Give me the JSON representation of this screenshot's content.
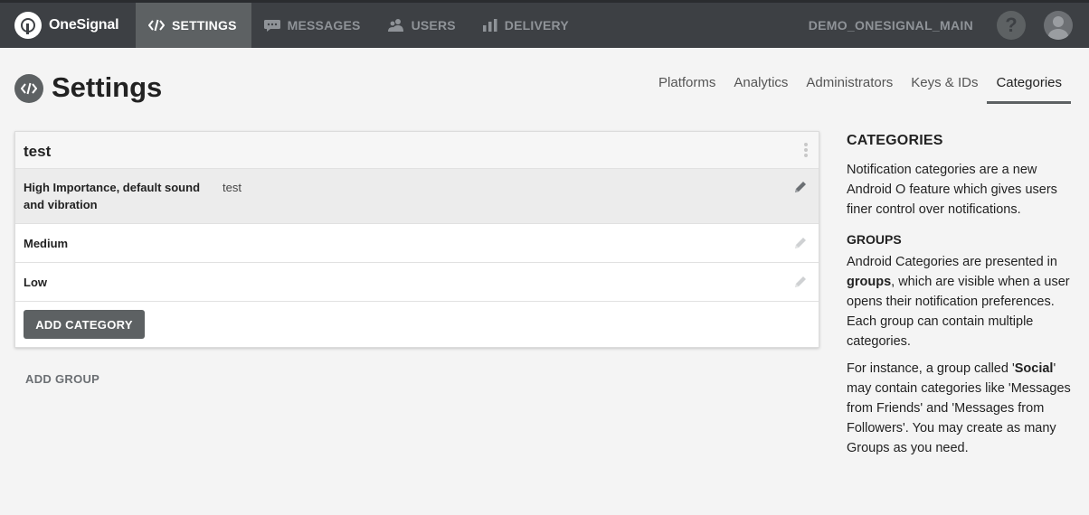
{
  "brand": {
    "name": "OneSignal"
  },
  "nav": {
    "items": [
      {
        "label": "SETTINGS",
        "icon": "code-icon",
        "active": true
      },
      {
        "label": "MESSAGES",
        "icon": "message-icon",
        "active": false
      },
      {
        "label": "USERS",
        "icon": "users-icon",
        "active": false
      },
      {
        "label": "DELIVERY",
        "icon": "bar-chart-icon",
        "active": false
      }
    ],
    "app_name": "DEMO_ONESIGNAL_MAIN",
    "help_label": "?"
  },
  "page": {
    "title": "Settings",
    "tabs": [
      {
        "label": "Platforms",
        "active": false
      },
      {
        "label": "Analytics",
        "active": false
      },
      {
        "label": "Administrators",
        "active": false
      },
      {
        "label": "Keys & IDs",
        "active": false
      },
      {
        "label": "Categories",
        "active": true
      }
    ]
  },
  "group": {
    "name": "test",
    "categories": [
      {
        "name": "High Importance, default sound and vibration",
        "description": "test"
      },
      {
        "name": "Medium",
        "description": ""
      },
      {
        "name": "Low",
        "description": ""
      }
    ],
    "add_category_label": "ADD CATEGORY"
  },
  "add_group_label": "ADD GROUP",
  "help": {
    "heading": "CATEGORIES",
    "intro": "Notification categories are a new Android O feature which gives users finer control over notifications.",
    "groups_heading": "GROUPS",
    "groups_p1_a": "Android Categories are presented in ",
    "groups_p1_bold": "groups",
    "groups_p1_b": ", which are visible when a user opens their notification preferences. Each group can contain multiple categories.",
    "groups_p2_a": "For instance, a group called '",
    "groups_p2_bold": "Social",
    "groups_p2_b": "' may contain categories like 'Messages from Friends' and 'Messages from Followers'. You may create as many Groups as you need."
  },
  "colors": {
    "topbar": "#3d4044",
    "active_nav": "#5d6163",
    "accent": "#5d6163"
  }
}
